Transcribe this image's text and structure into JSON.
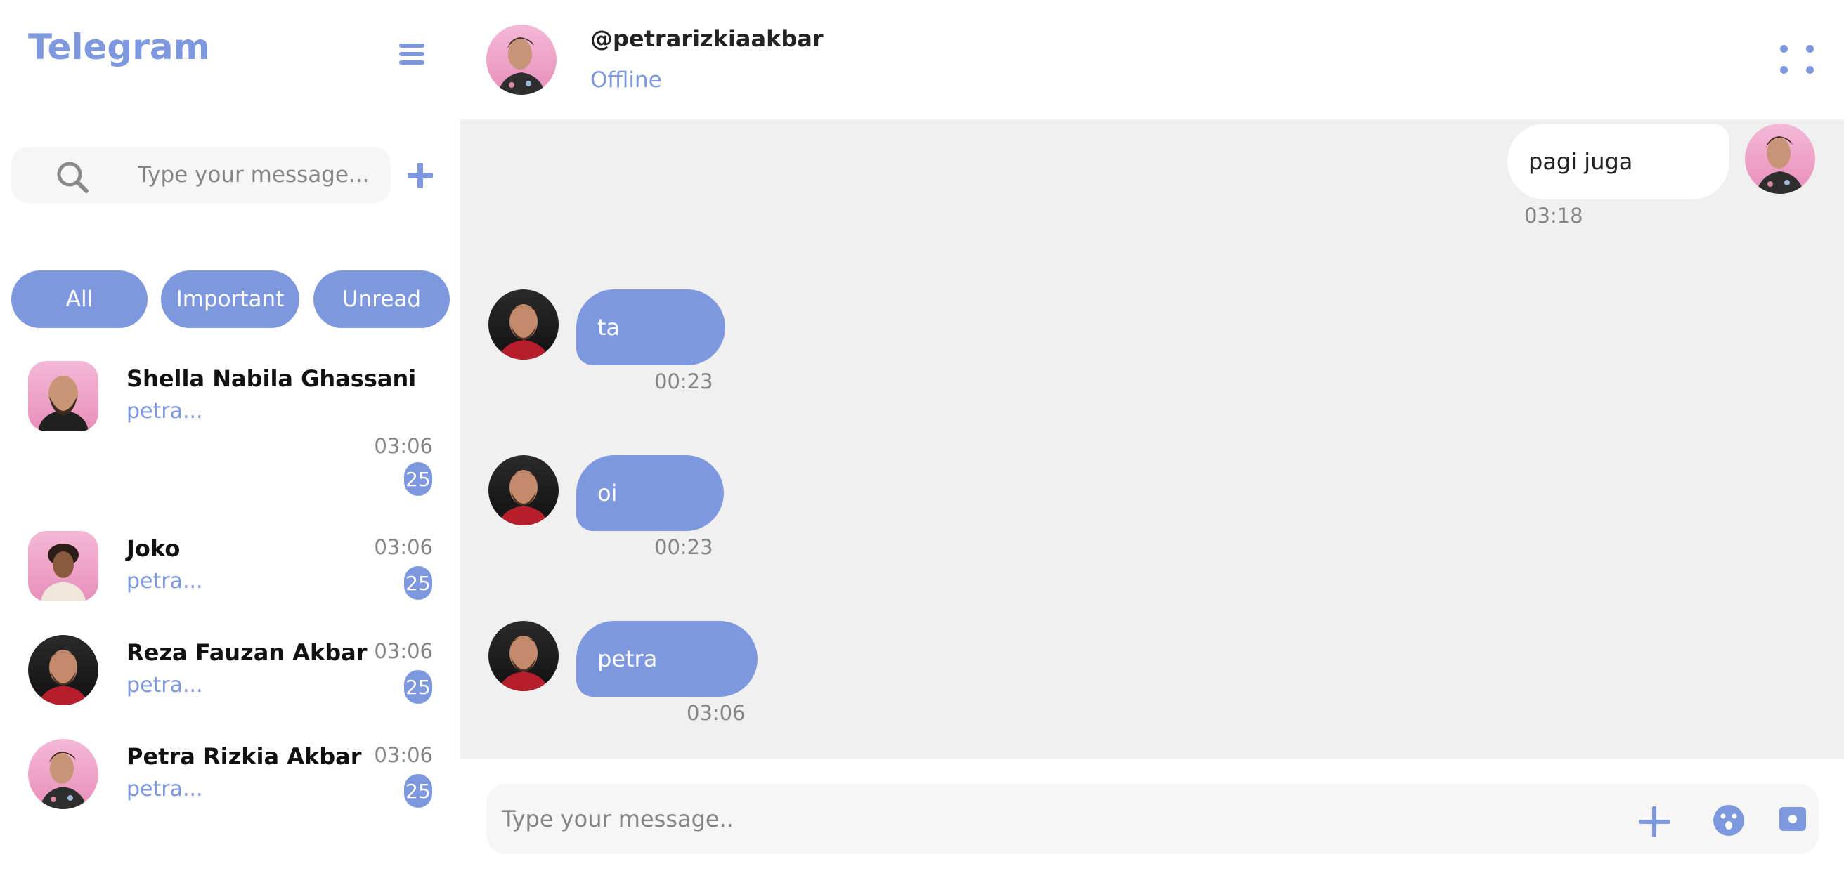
{
  "app": {
    "title": "Telegram"
  },
  "sidebar": {
    "menu_icon": "hamburger-menu-icon",
    "search": {
      "placeholder": "Type your message..."
    },
    "add_icon": "plus-icon",
    "filters": [
      {
        "label": "All",
        "active": true
      },
      {
        "label": "Important",
        "active": false
      },
      {
        "label": "Unread",
        "active": false
      }
    ],
    "contacts": [
      {
        "name": "Shella Nabila Ghassani",
        "preview": "petra...",
        "time": "03:06",
        "unread": "25"
      },
      {
        "name": "Joko",
        "preview": "petra...",
        "time": "03:06",
        "unread": "25"
      },
      {
        "name": "Reza Fauzan Akbar",
        "preview": "petra...",
        "time": "03:06",
        "unread": "25"
      },
      {
        "name": "Petra Rizkia Akbar",
        "preview": "petra...",
        "time": "03:06",
        "unread": "25"
      }
    ]
  },
  "chat": {
    "username": "@petrarizkiaakbar",
    "status": "Offline",
    "options_icon": "grid-dots-icon",
    "messages": [
      {
        "direction": "out",
        "text": "pagi juga",
        "time": "03:18"
      },
      {
        "direction": "in",
        "text": "ta",
        "time": "00:23"
      },
      {
        "direction": "in",
        "text": "oi",
        "time": "00:23"
      },
      {
        "direction": "in",
        "text": "petra",
        "time": "03:06"
      }
    ]
  },
  "composer": {
    "placeholder": "Type your message..",
    "icons": [
      "plus-icon",
      "emoji-icon",
      "camera-icon"
    ]
  },
  "colors": {
    "accent": "#7e98df",
    "chat_background": "#f0f0f0",
    "muted_text": "#848484"
  }
}
